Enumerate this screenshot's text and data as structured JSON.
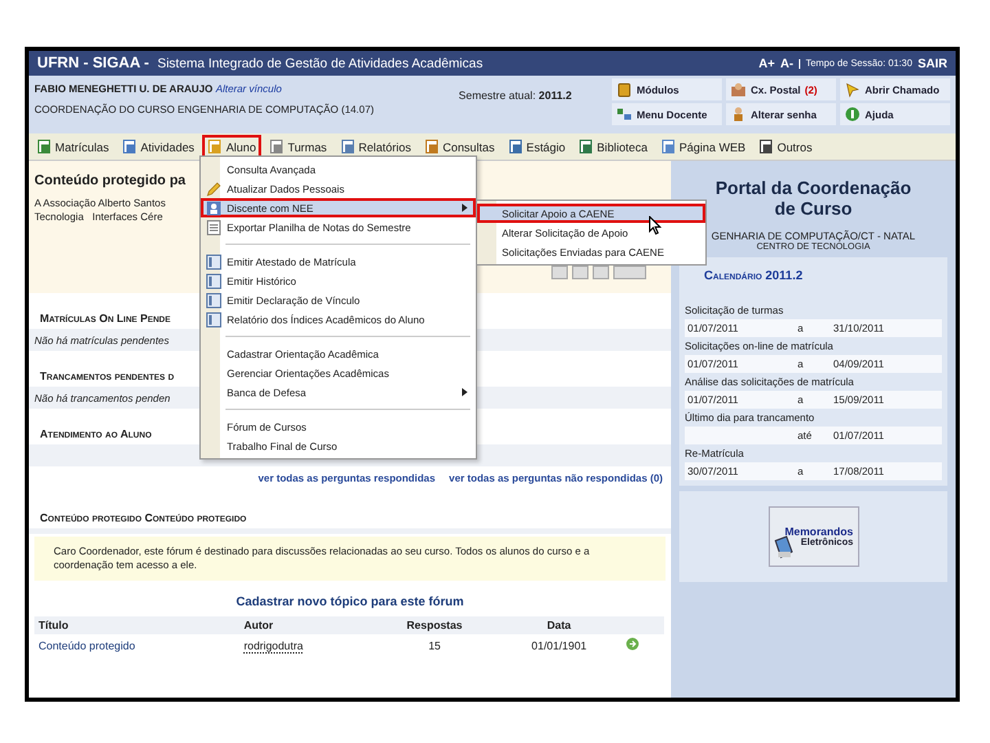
{
  "header": {
    "title": "UFRN - SIGAA -",
    "subtitle": "Sistema Integrado de Gestão de Atividades Acadêmicas",
    "font_controls": [
      "A+",
      "A-"
    ],
    "session": "Tempo de Sessão: 01:30",
    "logout": "SAIR"
  },
  "user": {
    "name": "FABIO MENEGHETTI U. DE ARAUJO",
    "change_link": "Alterar vínculo",
    "unit": "COORDENAÇÃO DO CURSO ENGENHARIA DE COMPUTAÇÃO (14.07)",
    "semester_label": "Semestre atual:",
    "semester": "2011.2"
  },
  "shortcuts": [
    {
      "label": "Módulos"
    },
    {
      "label": "Cx. Postal",
      "count": "(2)"
    },
    {
      "label": "Abrir Chamado"
    },
    {
      "label": "Menu Docente"
    },
    {
      "label": "Alterar senha"
    },
    {
      "label": "Ajuda"
    }
  ],
  "tabs": [
    {
      "label": "Matrículas",
      "annotated": false
    },
    {
      "label": "Atividades",
      "annotated": false
    },
    {
      "label": "Aluno",
      "annotated": true
    },
    {
      "label": "Turmas",
      "annotated": false
    },
    {
      "label": "Relatórios",
      "annotated": false
    },
    {
      "label": "Consultas",
      "annotated": false
    },
    {
      "label": "Estágio",
      "annotated": false
    },
    {
      "label": "Biblioteca",
      "annotated": false
    },
    {
      "label": "Página WEB",
      "annotated": false
    },
    {
      "label": "Outros",
      "annotated": false
    }
  ],
  "dropdown": {
    "groups": [
      {
        "items": [
          {
            "label": "Consulta Avançada",
            "kind": "plain",
            "submenu": false,
            "selected": false,
            "annotated": false
          },
          {
            "label": "Atualizar Dados Pessoais",
            "kind": "pencil",
            "submenu": false,
            "selected": false,
            "annotated": false
          },
          {
            "label": "Discente com NEE",
            "kind": "person",
            "submenu": true,
            "selected": true,
            "annotated": true
          },
          {
            "label": "Exportar Planilha de Notas do Semestre",
            "kind": "sheet",
            "submenu": false,
            "selected": false,
            "annotated": false
          }
        ]
      },
      {
        "items": [
          {
            "label": "Emitir Atestado de Matrícula",
            "kind": "document",
            "submenu": false,
            "selected": false,
            "annotated": false
          },
          {
            "label": "Emitir Histórico",
            "kind": "document",
            "submenu": false,
            "selected": false,
            "annotated": false
          },
          {
            "label": "Emitir Declaração de Vínculo",
            "kind": "document",
            "submenu": false,
            "selected": false,
            "annotated": false
          },
          {
            "label": "Relatório dos Índices Acadêmicos do Aluno",
            "kind": "document",
            "submenu": false,
            "selected": false,
            "annotated": false
          }
        ]
      },
      {
        "items": [
          {
            "label": "Cadastrar Orientação Acadêmica",
            "kind": "plain",
            "submenu": false,
            "selected": false,
            "annotated": false
          },
          {
            "label": "Gerenciar Orientações Acadêmicas",
            "kind": "plain",
            "submenu": false,
            "selected": false,
            "annotated": false
          },
          {
            "label": "Banca de Defesa",
            "kind": "plain",
            "submenu": true,
            "selected": false,
            "annotated": false
          }
        ]
      },
      {
        "items": [
          {
            "label": "Fórum de Cursos",
            "kind": "plain",
            "submenu": false,
            "selected": false,
            "annotated": false
          },
          {
            "label": "Trabalho Final de Curso",
            "kind": "plain",
            "submenu": false,
            "selected": false,
            "annotated": false
          }
        ]
      }
    ]
  },
  "submenu": {
    "items": [
      {
        "label": "Solicitar Apoio a CAENE",
        "selected": true,
        "annotated": true
      },
      {
        "label": "Alterar Solicitação de Apoio",
        "selected": false,
        "annotated": false
      },
      {
        "label": "Solicitações Enviadas para CAENE",
        "selected": false,
        "annotated": false
      }
    ]
  },
  "protected_box": {
    "title": "Conteúdo protegido pa",
    "lines": [
      "A Associação Alberto Santos",
      "Tecnologia   Interfaces Cére"
    ]
  },
  "sections": [
    {
      "title": "Matrículas On Line Pende",
      "message": "Não há matrículas pendentes"
    },
    {
      "title": "Trancamentos pendentes d",
      "message": "Não há trancamentos penden"
    },
    {
      "title": "Atendimento ao Aluno"
    }
  ],
  "question_links": [
    "ver todas as perguntas respondidas",
    "ver todas as perguntas não respondidas (0)"
  ],
  "forum": {
    "title": "Conteúdo protegido Conteúdo protegido",
    "notice": "Caro Coordenador, este fórum é destinado para discussões relacionadas ao seu curso. Todos os alunos do curso e a coordenação tem acesso a ele.",
    "new_topic": "Cadastrar novo tópico para este fórum",
    "columns": [
      "Título",
      "Autor",
      "Respostas",
      "Data"
    ],
    "rows": [
      {
        "title": "Conteúdo protegido",
        "author": "rodrigodutra",
        "replies": "15",
        "date": "01/01/1901"
      }
    ]
  },
  "portal": {
    "title": "Portal da Coordenação de Curso",
    "course": "GENHARIA DE COMPUTAÇÃO/CT - NATAL",
    "center": "CENTRO DE TECNOLOGIA"
  },
  "calendar": {
    "title": "Calendário 2011.2",
    "entries": [
      {
        "label": "Solicitação de turmas",
        "start": "01/07/2011",
        "sep": "a",
        "end": "31/10/2011"
      },
      {
        "label": "Solicitações on-line de matrícula",
        "start": "01/07/2011",
        "sep": "a",
        "end": "04/09/2011"
      },
      {
        "label": "Análise das solicitações de matrícula",
        "start": "01/07/2011",
        "sep": "a",
        "end": "15/09/2011"
      },
      {
        "label": "Último dia para trancamento",
        "sep": "até",
        "end": "01/07/2011"
      },
      {
        "label": "Re-Matrícula",
        "start": "30/07/2011",
        "sep": "a",
        "end": "17/08/2011"
      }
    ]
  },
  "memo_button": [
    "Memorandos",
    "Eletrônicos"
  ]
}
